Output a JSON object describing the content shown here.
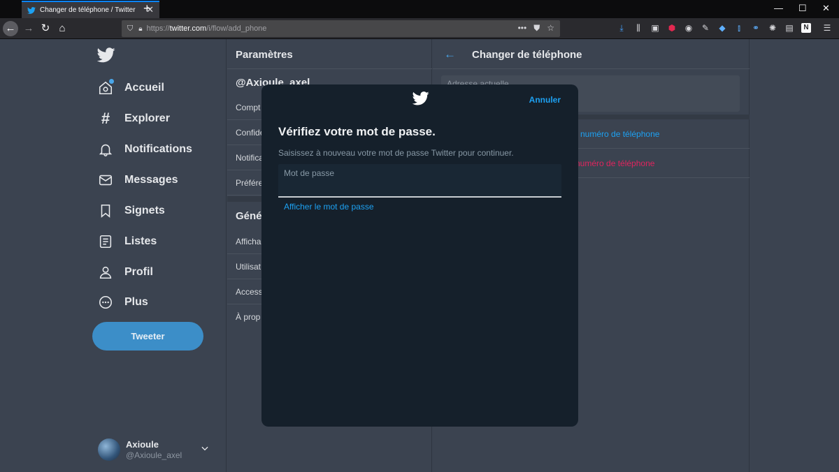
{
  "browser": {
    "tab_title": "Changer de téléphone / Twitter",
    "tab_close": "✕",
    "new_tab": "+",
    "url_scheme": "https://",
    "url_host": "twitter.com",
    "url_path": "/i/flow/add_phone",
    "window_minimize": "—",
    "window_maximize": "☐",
    "window_close": "✕"
  },
  "nav": {
    "items": [
      {
        "label": "Accueil",
        "icon": "home-icon"
      },
      {
        "label": "Explorer",
        "icon": "hashtag-icon"
      },
      {
        "label": "Notifications",
        "icon": "bell-icon"
      },
      {
        "label": "Messages",
        "icon": "mail-icon"
      },
      {
        "label": "Signets",
        "icon": "bookmark-icon"
      },
      {
        "label": "Listes",
        "icon": "list-icon"
      },
      {
        "label": "Profil",
        "icon": "profile-icon"
      },
      {
        "label": "Plus",
        "icon": "more-icon"
      }
    ],
    "tweet_button": "Tweeter",
    "account_name": "Axioule",
    "account_handle": "@Axioule_axel"
  },
  "settings": {
    "title": "Paramètres",
    "section_account": "@Axioule_axel",
    "rows_account": [
      "Compt",
      "Confide",
      "Notifica",
      "Préfére"
    ],
    "section_general": "Géné",
    "rows_general": [
      "Afficha",
      "Utilisat",
      "Accessi",
      "À prop"
    ]
  },
  "detail": {
    "title": "Changer de téléphone",
    "current_label": "Adresse actuelle",
    "update_link": "numéro de téléphone",
    "delete_link": "numéro de téléphone"
  },
  "modal": {
    "cancel": "Annuler",
    "title": "Vérifiez votre mot de passe.",
    "description": "Saisissez à nouveau votre mot de passe Twitter pour continuer.",
    "password_label": "Mot de passe",
    "password_value": "",
    "show_password": "Afficher le mot de passe"
  },
  "colors": {
    "accent": "#1da1f2",
    "danger": "#e0245e",
    "modal_bg": "#15202b",
    "page_bg": "#3b4350"
  }
}
